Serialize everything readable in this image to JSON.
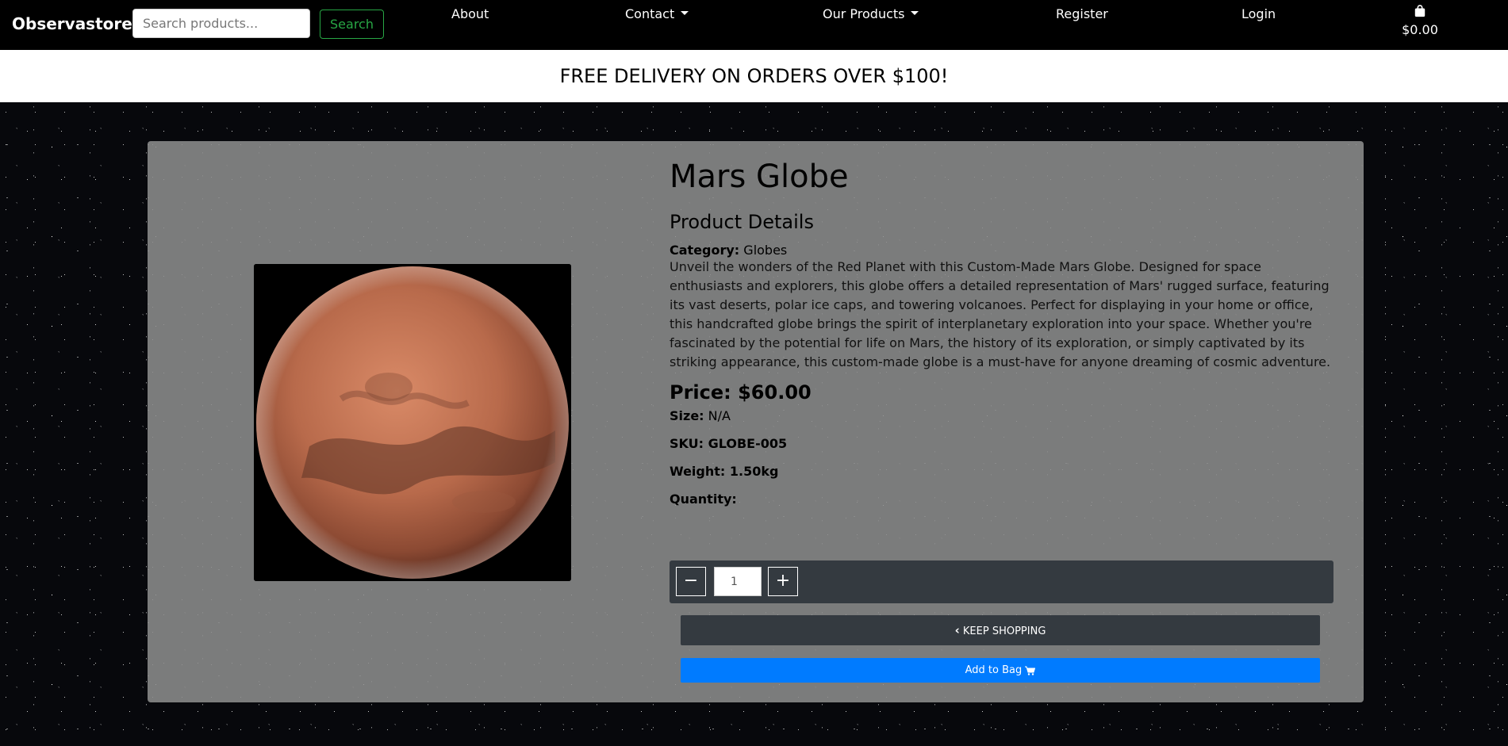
{
  "nav": {
    "brand": "Observastore",
    "search_placeholder": "Search products...",
    "search_label": "Search",
    "links": [
      {
        "label": "About"
      },
      {
        "label": "Contact"
      },
      {
        "label": "Our Products"
      },
      {
        "label": "Register"
      },
      {
        "label": "Login"
      }
    ],
    "bag_amount": "$0.00"
  },
  "banner": "FREE DELIVERY ON ORDERS OVER $100!",
  "product": {
    "title": "Mars Globe",
    "details_heading": "Product Details",
    "category_label": "Category:",
    "category": "Globes",
    "description": "Unveil the wonders of the Red Planet with this Custom-Made Mars Globe. Designed for space enthusiasts and explorers, this globe offers a detailed representation of Mars' rugged surface, featuring its vast deserts, polar ice caps, and towering volcanoes. Perfect for displaying in your home or office, this handcrafted globe brings the spirit of interplanetary exploration into your space. Whether you're fascinated by the potential for life on Mars, the history of its exploration, or simply captivated by its striking appearance, this custom-made globe is a must-have for anyone dreaming of cosmic adventure.",
    "price": "Price: $60.00",
    "size_label": "Size:",
    "size": "N/A",
    "sku": "SKU: GLOBE-005",
    "weight": "Weight: 1.50kg",
    "quantity_label": "Quantity:",
    "quantity_value": "1",
    "minus": "−",
    "plus": "+",
    "keep_shopping": "KEEP SHOPPING",
    "add_to_bag": "Add to Bag"
  },
  "colors": {
    "nav_bg": "#000000",
    "search_green": "#28a745",
    "dark_btn": "#343a40",
    "primary_blue": "#007bff"
  }
}
